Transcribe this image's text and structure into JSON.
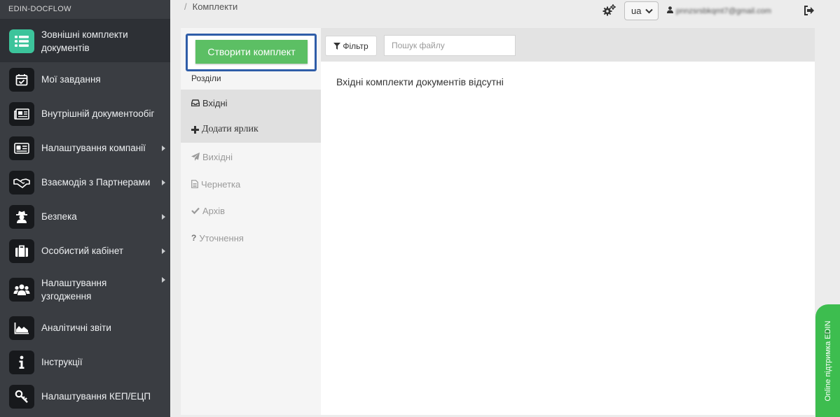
{
  "app": {
    "brand": "EDIN-DOCFLOW"
  },
  "sidebar": {
    "items": [
      {
        "label": "Зовнішні комплекти документів",
        "icon": "list-icon",
        "active": true,
        "submenu": false
      },
      {
        "label": "Мої завдання",
        "icon": "calendar-check-icon",
        "active": false,
        "submenu": false
      },
      {
        "label": "Внутрішній документообіг",
        "icon": "newspaper-icon",
        "active": false,
        "submenu": false
      },
      {
        "label": "Налаштування компанії",
        "icon": "id-card-icon",
        "active": false,
        "submenu": true
      },
      {
        "label": "Взаємодія з Партнерами",
        "icon": "handshake-icon",
        "active": false,
        "submenu": true
      },
      {
        "label": "Безпека",
        "icon": "user-secret-icon",
        "active": false,
        "submenu": true
      },
      {
        "label": "Особистий кабінет",
        "icon": "briefcase-icon",
        "active": false,
        "submenu": true
      },
      {
        "label": "Налаштування узгодження",
        "icon": "users-icon",
        "active": false,
        "submenu": true
      },
      {
        "label": "Аналітичні звіти",
        "icon": "area-chart-icon",
        "active": false,
        "submenu": false
      },
      {
        "label": "Інструкції",
        "icon": "info-icon",
        "active": false,
        "submenu": false
      },
      {
        "label": "Налаштування КЕП/ЕЦП",
        "icon": "key-icon",
        "active": false,
        "submenu": false
      }
    ]
  },
  "topbar": {
    "breadcrumb_sep": "/",
    "breadcrumb": "Комплекти",
    "language": "ua",
    "user_email": "pnnzsrsbkqmt7@gmail.com",
    "icons": {
      "settings": "gears-icon",
      "language_dropdown": "chevron-down-icon",
      "user": "user-icon",
      "logout": "sign-out-icon"
    }
  },
  "sections": {
    "create_button": "Створити комплект",
    "title": "Розділи",
    "items": [
      {
        "label": "Вхідні",
        "icon": "inbox-icon",
        "selected": true
      },
      {
        "label": "Додати ярлик",
        "icon": "plus-icon",
        "selected": true
      },
      {
        "label": "Вихідні",
        "icon": "paper-plane-icon",
        "selected": false
      },
      {
        "label": "Чернетка",
        "icon": "file-text-icon",
        "selected": false
      },
      {
        "label": "Архів",
        "icon": "check-icon",
        "selected": false
      },
      {
        "label": "Уточнення",
        "icon": "question-icon",
        "selected": false
      }
    ]
  },
  "toolbar": {
    "filter_label": "Фільтр",
    "search_placeholder": "Пошук файлу"
  },
  "main": {
    "empty_message": "Вхідні комплекти документів відсутні"
  },
  "support": {
    "label": "Online підтримка EDIN"
  },
  "colors": {
    "sidebar_bg": "#3a3d42",
    "active_icon_bg": "#3cc49b",
    "create_button": "#5cbf64",
    "highlight_border": "#2f5da8",
    "support_tab": "#3dbd4f"
  }
}
